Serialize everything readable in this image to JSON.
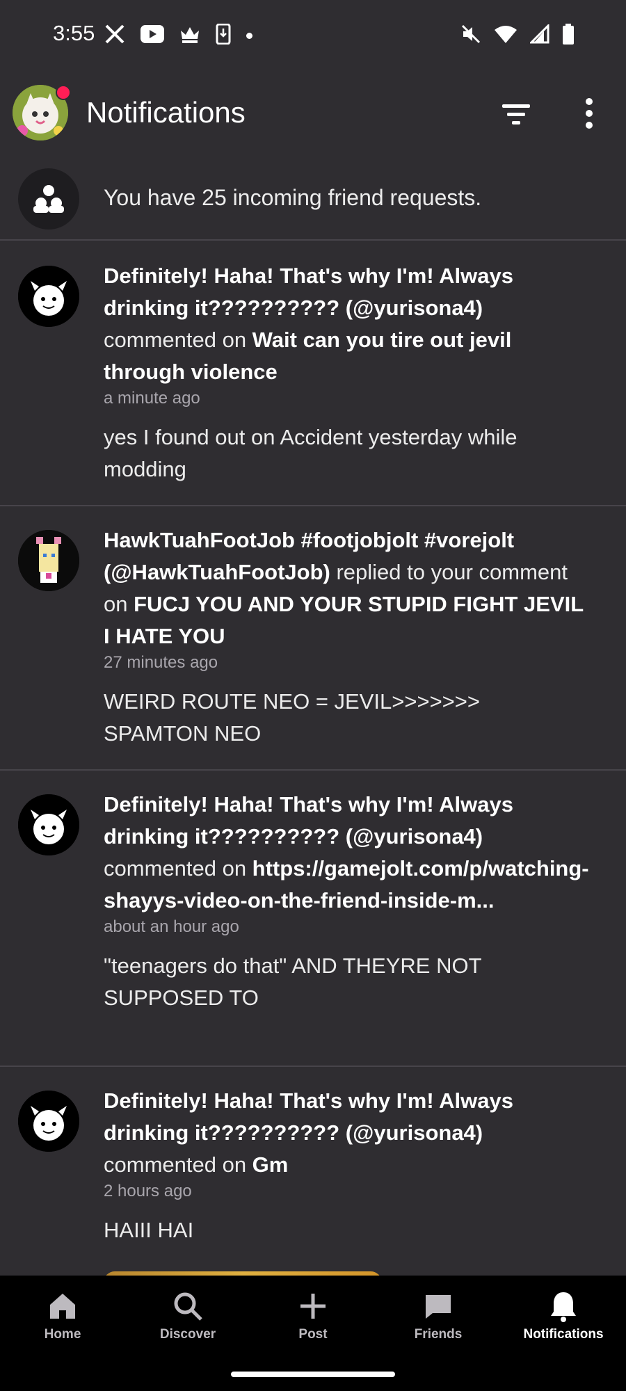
{
  "status_bar": {
    "time": "3:55",
    "left_icons": [
      "x-icon",
      "youtube-icon",
      "crown-icon",
      "phone-icon",
      "dot-icon"
    ],
    "right_icons": [
      "mute-icon",
      "wifi-icon",
      "signal-icon",
      "battery-icon"
    ]
  },
  "header": {
    "title": "Notifications",
    "has_unread_dot": true
  },
  "friend_requests": {
    "text": "You have 25 incoming friend requests."
  },
  "notifications": [
    {
      "user": "Definitely! Haha! That's why I'm! Always drinking it?????????? (@yurisona4)",
      "action": " commented on ",
      "target": "Wait can you tire out jevil through violence",
      "time": "a minute ago",
      "message": "yes  I found out on Accident yesterday while modding"
    },
    {
      "user": "HawkTuahFootJob #footjobjolt #vorejolt (@HawkTuahFootJob)",
      "action": " replied to your comment on ",
      "target": "FUCJ YOU AND YOUR STUPID FIGHT JEVIL I HATE YOU",
      "time": "27 minutes ago",
      "message": "WEIRD ROUTE NEO = JEVIL>>>>>>> SPAMTON NEO"
    },
    {
      "user": "Definitely! Haha! That's why I'm! Always drinking it?????????? (@yurisona4)",
      "action": " commented on ",
      "target": "https://gamejolt.com/p/watching-shayys-video-on-the-friend-inside-m...",
      "time": "about an hour ago",
      "message": "\"teenagers do that\" AND THEYRE NOT SUPPOSED TO"
    },
    {
      "user": "Definitely! Haha! That's why I'm! Always drinking it?????????? (@yurisona4)",
      "action": " commented on ",
      "target": "Gm",
      "time": "2 hours ago",
      "message": "HAIII HAI"
    }
  ],
  "bottom_nav": {
    "items": [
      {
        "label": "Home",
        "icon": "home-icon"
      },
      {
        "label": "Discover",
        "icon": "search-icon"
      },
      {
        "label": "Post",
        "icon": "plus-icon"
      },
      {
        "label": "Friends",
        "icon": "chat-icon"
      },
      {
        "label": "Notifications",
        "icon": "bell-icon",
        "active": true
      }
    ]
  }
}
